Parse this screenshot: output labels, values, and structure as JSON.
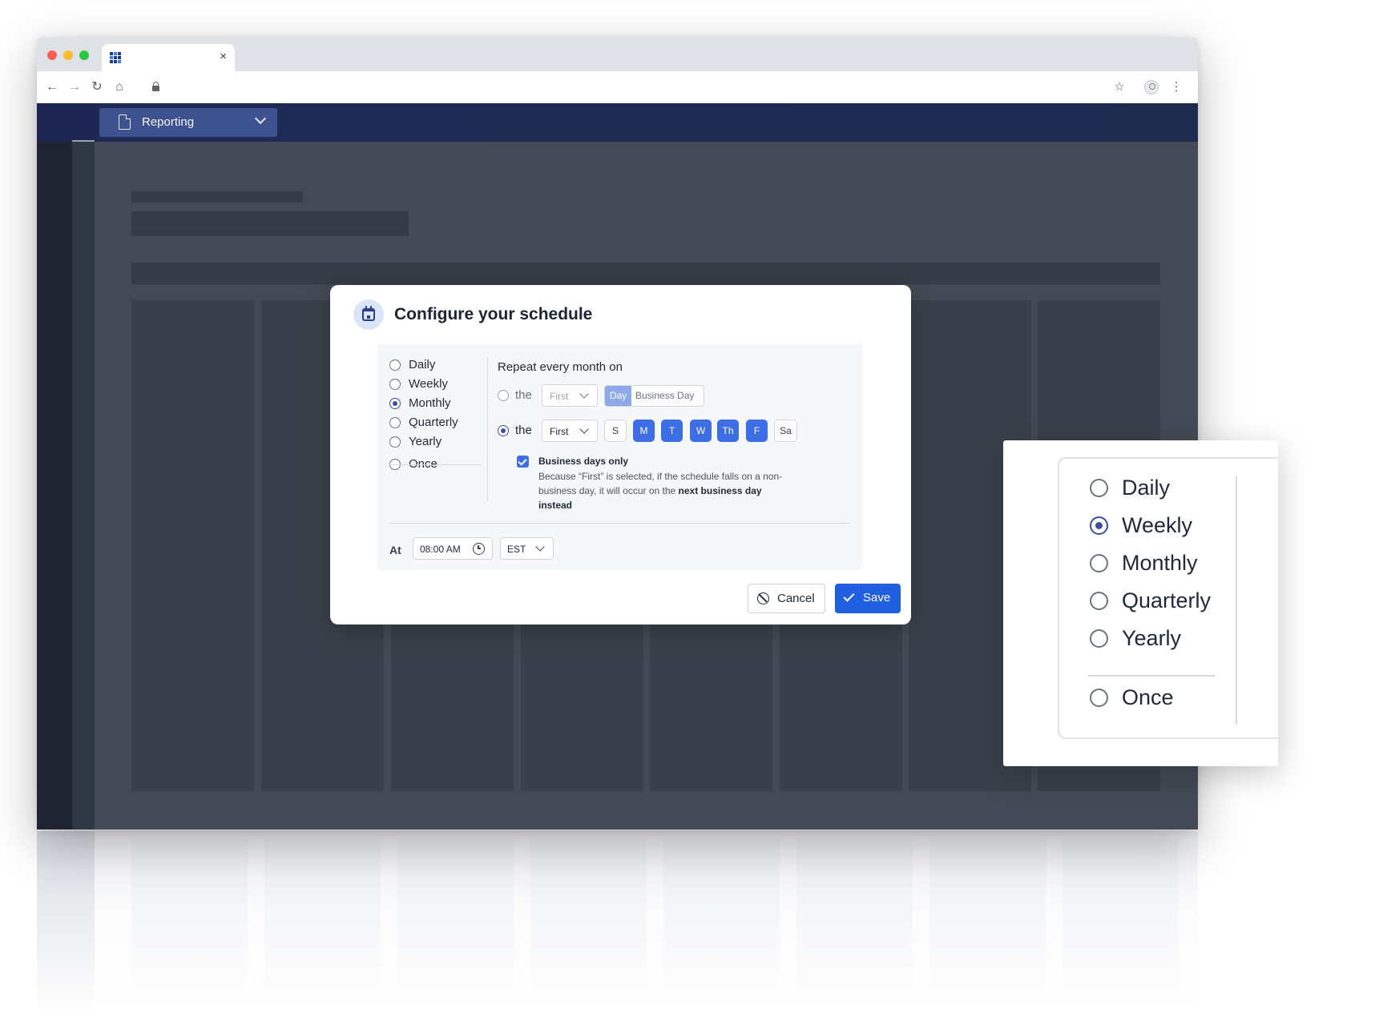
{
  "browser": {
    "tab": {
      "close_glyph": "×"
    },
    "toolbar": {
      "back": "←",
      "forward": "→",
      "reload": "↻",
      "home": "⌂",
      "star": "☆",
      "menu": "⋮"
    }
  },
  "app": {
    "report_select": {
      "label": "Reporting"
    }
  },
  "modal": {
    "title": "Configure your schedule",
    "frequencies": [
      {
        "label": "Daily",
        "selected": false
      },
      {
        "label": "Weekly",
        "selected": false
      },
      {
        "label": "Monthly",
        "selected": true
      },
      {
        "label": "Quarterly",
        "selected": false
      },
      {
        "label": "Yearly",
        "selected": false
      },
      {
        "label": "Once",
        "selected": false
      }
    ],
    "repeat_title": "Repeat every month on",
    "option1": {
      "prefix": "the",
      "ordinal": "First",
      "segment_selected": "Day",
      "segment_other": "Business Day"
    },
    "option2": {
      "prefix": "the",
      "ordinal": "First",
      "days": [
        {
          "label": "S",
          "selected": false
        },
        {
          "label": "M",
          "selected": true
        },
        {
          "label": "T",
          "selected": true
        },
        {
          "label": "W",
          "selected": true
        },
        {
          "label": "Th",
          "selected": true
        },
        {
          "label": "F",
          "selected": true
        },
        {
          "label": "Sa",
          "selected": false
        }
      ]
    },
    "business_days": {
      "label": "Business days only",
      "checked": true,
      "note_part1": "Because “First” is selected, if the schedule falls on a non-business day, it will occur on the ",
      "note_bold": "next business day instead"
    },
    "at_label": "At",
    "time_value": "08:00 AM",
    "timezone": "EST",
    "cancel_label": "Cancel",
    "save_label": "Save"
  },
  "zoom": {
    "frequencies": [
      {
        "label": "Daily",
        "selected": false
      },
      {
        "label": "Weekly",
        "selected": true
      },
      {
        "label": "Monthly",
        "selected": false
      },
      {
        "label": "Quarterly",
        "selected": false
      },
      {
        "label": "Yearly",
        "selected": false
      },
      {
        "label": "Once",
        "selected": false
      }
    ]
  },
  "colors": {
    "accent": "#3d6ee6",
    "primary_button": "#1f5fe0",
    "header": "#1e2a55",
    "radio_selected": "#3a4f9e"
  }
}
